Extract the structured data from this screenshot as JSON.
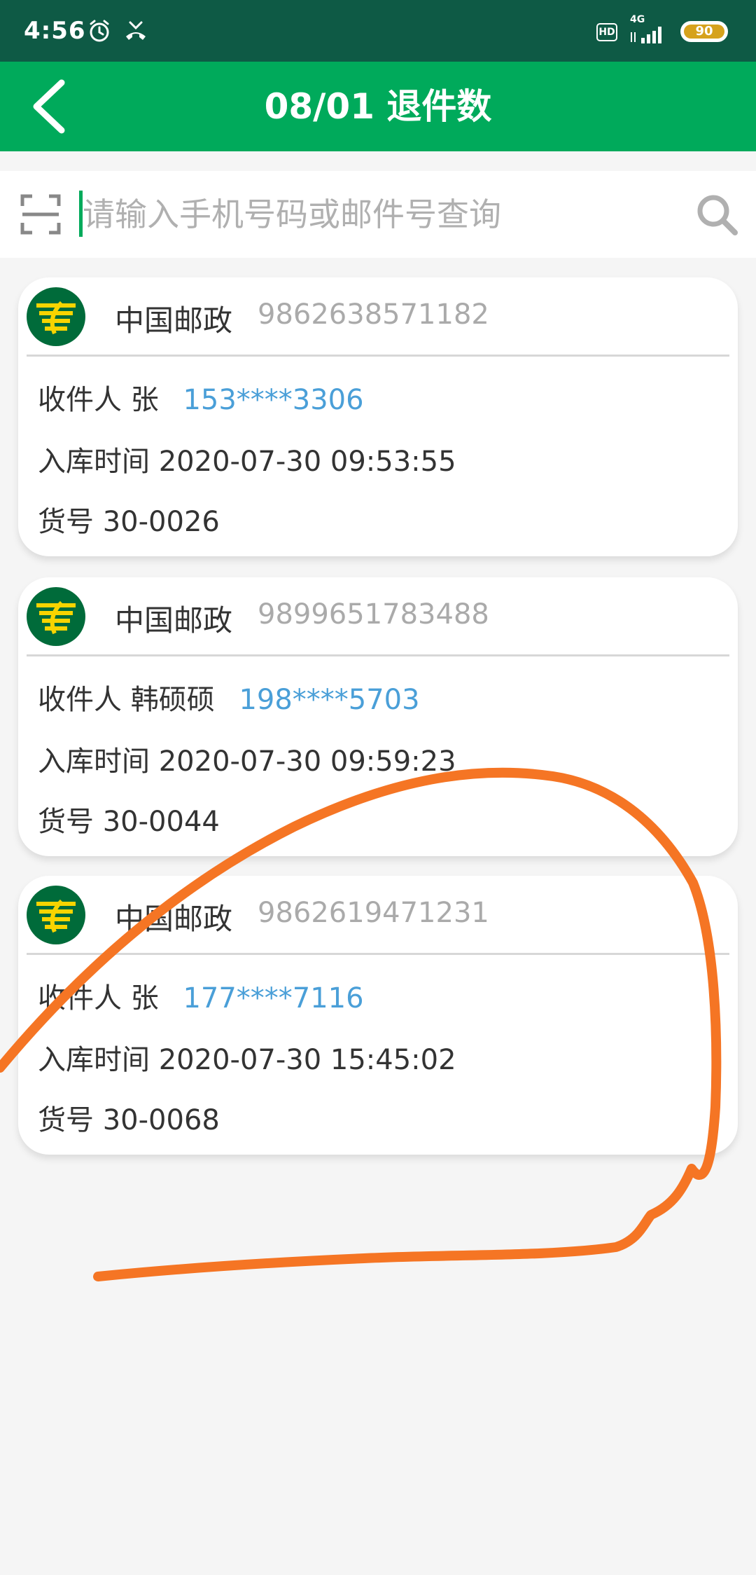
{
  "status_bar": {
    "time": "4:56",
    "icons": [
      "alarm-icon",
      "missed-call-icon",
      "hd-icon",
      "4g-signal-icon",
      "battery-icon"
    ],
    "network": "4G",
    "hd_label": "HD",
    "battery_level": "90"
  },
  "header": {
    "title": "08/01 退件数",
    "back_icon": "chevron-left-icon",
    "background_color": "#00aa5b"
  },
  "search": {
    "placeholder": "请输入手机号码或邮件号查询",
    "value": "",
    "scan_icon": "scan-icon",
    "search_icon": "search-icon"
  },
  "parcels": [
    {
      "carrier": "中国邮政",
      "tracking_number": "9862638571182",
      "recipient_label": "收件人",
      "recipient_name": "张",
      "phone": "153****3306",
      "time_label": "入库时间",
      "stored_time": "2020-07-30 09:53:55",
      "code_label": "货号",
      "code": "30-0026"
    },
    {
      "carrier": "中国邮政",
      "tracking_number": "9899651783488",
      "recipient_label": "收件人",
      "recipient_name": "韩硕硕",
      "phone": "198****5703",
      "time_label": "入库时间",
      "stored_time": "2020-07-30 09:59:23",
      "code_label": "货号",
      "code": "30-0044"
    },
    {
      "carrier": "中国邮政",
      "tracking_number": "9862619471231",
      "recipient_label": "收件人",
      "recipient_name": "张",
      "phone": "177****7116",
      "time_label": "入库时间",
      "stored_time": "2020-07-30 15:45:02",
      "code_label": "货号",
      "code": "30-0068"
    }
  ],
  "colors": {
    "accent": "#00aa5b",
    "status_bar": "#0e5a45",
    "phone_text": "#4a9fd8",
    "annotation_stroke": "#f57524"
  }
}
